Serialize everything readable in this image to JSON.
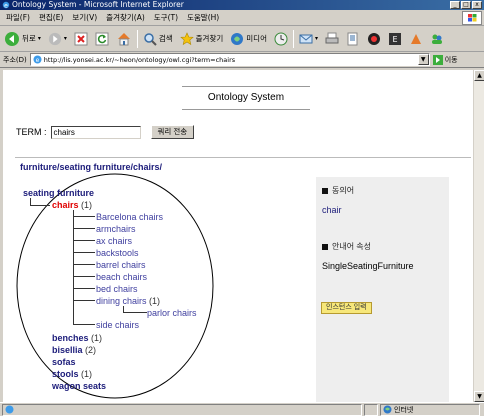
{
  "window": {
    "title": "Ontology System - Microsoft Internet Explorer",
    "buttons": [
      "_",
      "□",
      "x"
    ]
  },
  "menu": {
    "items": [
      "파일(F)",
      "편집(E)",
      "보기(V)",
      "즐겨찾기(A)",
      "도구(T)",
      "도움말(H)"
    ]
  },
  "toolbar": {
    "back": "뒤로",
    "search": "검색",
    "favorites": "즐겨찾기",
    "media": "미디어"
  },
  "address": {
    "label": "주소(D)",
    "url": "http://lis.yonsei.ac.kr/~heon/ontology/owl.cgi?term=chairs",
    "go": "이동"
  },
  "page": {
    "site_title": "Ontology System",
    "term_label": "TERM :",
    "term_value": "chairs",
    "query_button": "쿼리 전송",
    "breadcrumb": "furniture/seating furniture/chairs/"
  },
  "tree": {
    "root": "seating furniture",
    "current": "chairs",
    "current_count": "(1)",
    "children": [
      "Barcelona chairs",
      "armchairs",
      "ax chairs",
      "backstools",
      "barrel chairs",
      "beach chairs",
      "bed chairs",
      "dining chairs",
      "side chairs"
    ],
    "dining_count": "(1)",
    "grandchild": "parlor chairs",
    "siblings": [
      {
        "label": "benches",
        "count": "(1)"
      },
      {
        "label": "bisellia",
        "count": "(2)"
      },
      {
        "label": "sofas",
        "count": ""
      },
      {
        "label": "stools",
        "count": "(1)"
      },
      {
        "label": "wagon seats",
        "count": ""
      }
    ]
  },
  "panel": {
    "synonym_header": "동의어",
    "synonym_value": "chair",
    "property_header": "안내어 속성",
    "property_value": "SingleSeatingFurniture",
    "instance_button": "인스턴스 입력"
  },
  "status": {
    "zone": "인터넷"
  },
  "colors": {
    "link": "#3f3f9f",
    "bold_link": "#1c1c7a",
    "current": "#e00000",
    "panel_bg": "#eeeeee",
    "button_yellow": "#f7e77a"
  }
}
